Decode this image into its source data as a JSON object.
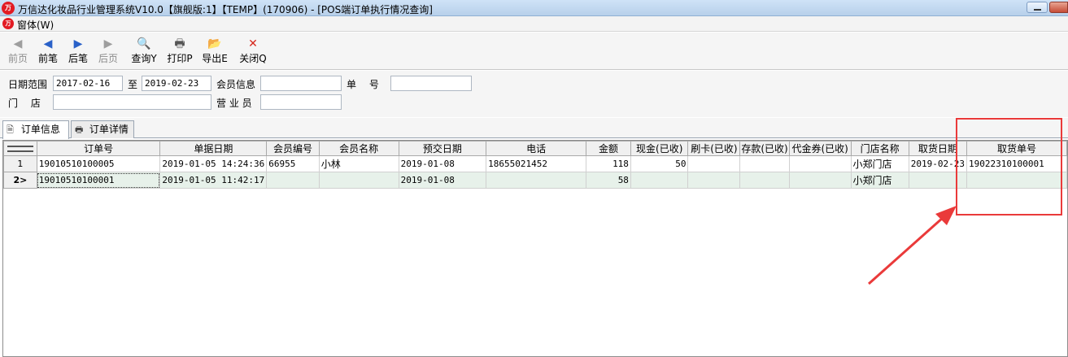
{
  "window": {
    "logo_text": "万",
    "title": "万信达化妆品行业管理系统V10.0【旗舰版:1】【TEMP】(170906) - [POS端订单执行情况查询]"
  },
  "menu": {
    "items": [
      {
        "label": "窗体(W)"
      }
    ]
  },
  "toolbar": {
    "buttons": [
      {
        "label": "前页",
        "icon": "prev-page-icon",
        "glyph": "◀",
        "enabled": false
      },
      {
        "label": "前笔",
        "icon": "prev-record-icon",
        "glyph": "◀",
        "enabled": true
      },
      {
        "label": "后笔",
        "icon": "next-record-icon",
        "glyph": "▶",
        "enabled": true
      },
      {
        "label": "后页",
        "icon": "next-page-icon",
        "glyph": "▶",
        "enabled": false
      },
      {
        "label": "查询Y",
        "icon": "query-icon",
        "glyph": "🔍",
        "enabled": true
      },
      {
        "label": "打印P",
        "icon": "print-icon",
        "glyph": "🖶",
        "enabled": true
      },
      {
        "label": "导出E",
        "icon": "export-icon",
        "glyph": "📂",
        "enabled": true
      },
      {
        "label": "关闭Q",
        "icon": "close-icon",
        "glyph": "✕",
        "enabled": true
      }
    ]
  },
  "filters": {
    "date_range_label": "日期范围",
    "date_from": "2017-02-16",
    "to_label": "至",
    "date_to": "2019-02-23",
    "member_label": "会员信息",
    "member_value": "",
    "order_no_label": "单　 号",
    "order_no_value": "",
    "store_label": "门　 店",
    "store_value": "",
    "salesperson_label": "营 业 员",
    "salesperson_value": ""
  },
  "tabs": [
    {
      "label": "订单信息",
      "active": true
    },
    {
      "label": "订单详情",
      "active": false
    }
  ],
  "grid": {
    "columns": [
      "订单号",
      "单据日期",
      "会员编号",
      "会员名称",
      "预交日期",
      "电话",
      "金额",
      "现金(已收)",
      "刷卡(已收)",
      "存款(已收)",
      "代金券(已收)",
      "门店名称",
      "取货日期",
      "取货单号"
    ],
    "rows": [
      {
        "indicator": "1",
        "cells": [
          "19010510100005",
          "2019-01-05 14:24:36",
          "66955",
          "小林",
          "2019-01-08",
          "18655021452",
          "118",
          "50",
          "",
          "",
          "",
          "小郑门店",
          "2019-02-23",
          "19022310100001"
        ]
      },
      {
        "indicator": "2>",
        "cells": [
          "19010510100001",
          "2019-01-05 11:42:17",
          "",
          "",
          "2019-01-08",
          "",
          "58",
          "",
          "",
          "",
          "",
          "小郑门店",
          "",
          ""
        ]
      }
    ]
  },
  "colors": {
    "annotation": "#ea3a3a",
    "selected_row": "#e7f1ea"
  }
}
